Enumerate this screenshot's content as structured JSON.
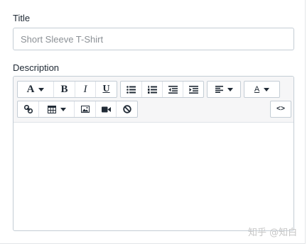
{
  "form": {
    "title_label": "Title",
    "title_placeholder": "Short Sleeve T-Shirt",
    "title_value": "",
    "description_label": "Description"
  },
  "toolbar": {
    "font_glyph": "A",
    "bold_glyph": "B",
    "italic_glyph": "I",
    "underline_glyph": "U",
    "font_color_glyph": "A",
    "code_glyph": "<>"
  },
  "icons": {
    "font": "font-icon",
    "bold": "bold-icon",
    "italic": "italic-icon",
    "underline": "underline-icon",
    "bullet_list": "bullet-list-icon",
    "numbered_list": "numbered-list-icon",
    "outdent": "outdent-icon",
    "indent": "indent-icon",
    "align": "align-left-icon",
    "font_color": "font-color-icon",
    "link": "link-icon",
    "table": "table-icon",
    "image": "image-icon",
    "video": "video-icon",
    "clear_format": "clear-formatting-icon",
    "source": "code-view-icon"
  },
  "watermark": "知乎 @知白",
  "colors": {
    "border": "#c4cdd5",
    "toolbar_bg": "#f6f6f7",
    "text": "#212b36",
    "placeholder": "#8c9196"
  }
}
